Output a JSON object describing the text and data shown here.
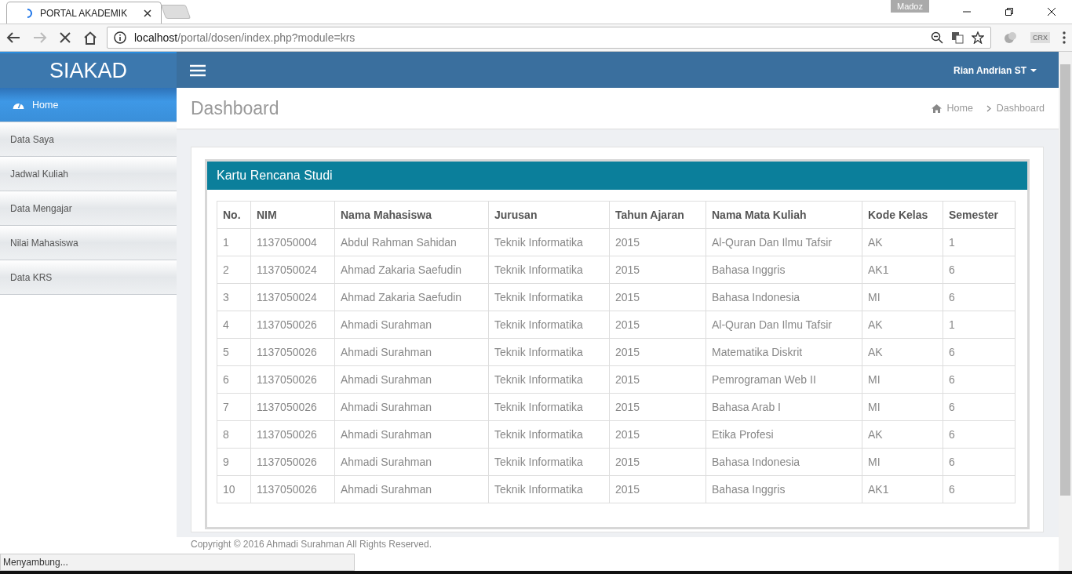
{
  "browser": {
    "tabs": [
      {
        "title": "PORTAL AKADEMIK",
        "selected": true
      },
      {
        "selected": false
      }
    ],
    "profile": "Madoz",
    "url_host": "localhost",
    "url_path": "/portal/dosen/index.php?module=krs",
    "extension_label": "CRX",
    "status": "Menyambung..."
  },
  "brand": "SIAKAD",
  "sidebar": {
    "items": [
      {
        "label": "Home",
        "selected": true,
        "kind": "icon"
      },
      {
        "label": "Data Saya",
        "selected": false,
        "kind": "text"
      },
      {
        "label": "Jadwal Kuliah",
        "selected": false,
        "kind": "text"
      },
      {
        "label": "Data Mengajar",
        "selected": false,
        "kind": "text"
      },
      {
        "label": "Nilai Mahasiswa",
        "selected": false,
        "kind": "text"
      },
      {
        "label": "Data KRS",
        "selected": false,
        "kind": "text"
      }
    ]
  },
  "user_menu": "Rian Andrian ST",
  "page_title": "Dashboard",
  "breadcrumb": [
    "Home",
    "Dashboard"
  ],
  "card_title": "Kartu Rencana Studi",
  "table": {
    "columns": [
      "No.",
      "NIM",
      "Nama Mahasiswa",
      "Jurusan",
      "Tahun Ajaran",
      "Nama Mata Kuliah",
      "Kode Kelas",
      "Semester"
    ],
    "rows": [
      [
        "1",
        "1137050004",
        "Abdul Rahman Sahidan",
        "Teknik Informatika",
        "2015",
        "Al-Quran Dan Ilmu Tafsir",
        "AK",
        "1"
      ],
      [
        "2",
        "1137050024",
        "Ahmad Zakaria Saefudin",
        "Teknik Informatika",
        "2015",
        "Bahasa Inggris",
        "AK1",
        "6"
      ],
      [
        "3",
        "1137050024",
        "Ahmad Zakaria Saefudin",
        "Teknik Informatika",
        "2015",
        "Bahasa Indonesia",
        "MI",
        "6"
      ],
      [
        "4",
        "1137050026",
        "Ahmadi Surahman",
        "Teknik Informatika",
        "2015",
        "Al-Quran Dan Ilmu Tafsir",
        "AK",
        "1"
      ],
      [
        "5",
        "1137050026",
        "Ahmadi Surahman",
        "Teknik Informatika",
        "2015",
        "Matematika Diskrit",
        "AK",
        "6"
      ],
      [
        "6",
        "1137050026",
        "Ahmadi Surahman",
        "Teknik Informatika",
        "2015",
        "Pemrograman Web II",
        "MI",
        "6"
      ],
      [
        "7",
        "1137050026",
        "Ahmadi Surahman",
        "Teknik Informatika",
        "2015",
        "Bahasa Arab I",
        "MI",
        "6"
      ],
      [
        "8",
        "1137050026",
        "Ahmadi Surahman",
        "Teknik Informatika",
        "2015",
        "Etika Profesi",
        "AK",
        "6"
      ],
      [
        "9",
        "1137050026",
        "Ahmadi Surahman",
        "Teknik Informatika",
        "2015",
        "Bahasa Indonesia",
        "MI",
        "6"
      ],
      [
        "10",
        "1137050026",
        "Ahmadi Surahman",
        "Teknik Informatika",
        "2015",
        "Bahasa Inggris",
        "AK1",
        "6"
      ]
    ]
  },
  "footer": "Copyright © 2016 Ahmadi Surahman All Rights Reserved."
}
